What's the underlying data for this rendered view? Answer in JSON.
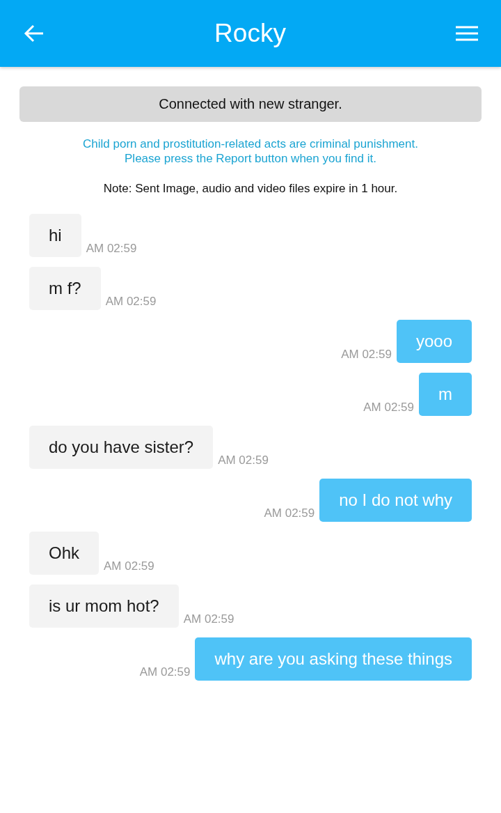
{
  "header": {
    "title": "Rocky"
  },
  "notice": {
    "text": "Connected with new stranger."
  },
  "warning": {
    "lines": [
      "Child porn and prostitution-related acts are criminal punishment.",
      "Please press the Report button when you find it."
    ]
  },
  "note": {
    "text": "Note: Sent Image, audio and video files expire in 1 hour."
  },
  "messages": [
    {
      "kind": "received",
      "text": "hi",
      "time": "AM 02:59"
    },
    {
      "kind": "received",
      "text": "m f?",
      "time": "AM 02:59"
    },
    {
      "kind": "sent",
      "text": "yooo",
      "time": "AM 02:59"
    },
    {
      "kind": "sent",
      "text": "m",
      "time": "AM 02:59"
    },
    {
      "kind": "received",
      "text": "do you have sister?",
      "time": "AM 02:59"
    },
    {
      "kind": "sent",
      "text": "no I do not why",
      "time": "AM 02:59"
    },
    {
      "kind": "received",
      "text": "Ohk",
      "time": "AM 02:59"
    },
    {
      "kind": "received",
      "text": "is ur mom hot?",
      "time": "AM 02:59"
    },
    {
      "kind": "sent",
      "text": "why are you asking these things",
      "time": "AM 02:59"
    }
  ]
}
